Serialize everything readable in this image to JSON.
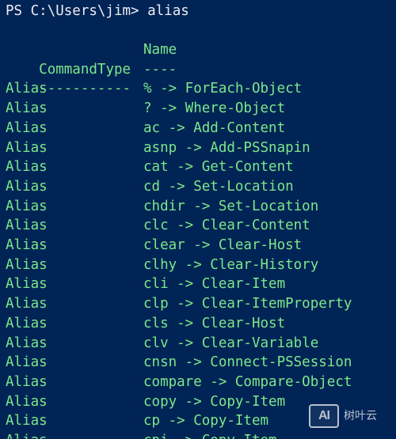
{
  "prompt": {
    "text": "PS C:\\Users\\jim> alias"
  },
  "table": {
    "headers": [
      "CommandType",
      "Name"
    ],
    "separators": [
      "-----------",
      "----"
    ],
    "rows": [
      {
        "type": "Alias",
        "name": "% -> ForEach-Object"
      },
      {
        "type": "Alias",
        "name": "? -> Where-Object"
      },
      {
        "type": "Alias",
        "name": "ac -> Add-Content"
      },
      {
        "type": "Alias",
        "name": "asnp -> Add-PSSnapin"
      },
      {
        "type": "Alias",
        "name": "cat -> Get-Content"
      },
      {
        "type": "Alias",
        "name": "cd -> Set-Location"
      },
      {
        "type": "Alias",
        "name": "chdir -> Set-Location"
      },
      {
        "type": "Alias",
        "name": "clc -> Clear-Content"
      },
      {
        "type": "Alias",
        "name": "clear -> Clear-Host"
      },
      {
        "type": "Alias",
        "name": "clhy -> Clear-History"
      },
      {
        "type": "Alias",
        "name": "cli -> Clear-Item"
      },
      {
        "type": "Alias",
        "name": "clp -> Clear-ItemProperty"
      },
      {
        "type": "Alias",
        "name": "cls -> Clear-Host"
      },
      {
        "type": "Alias",
        "name": "clv -> Clear-Variable"
      },
      {
        "type": "Alias",
        "name": "cnsn -> Connect-PSSession"
      },
      {
        "type": "Alias",
        "name": "compare -> Compare-Object"
      },
      {
        "type": "Alias",
        "name": "copy -> Copy-Item"
      },
      {
        "type": "Alias",
        "name": "cp -> Copy-Item"
      },
      {
        "type": "Alias",
        "name": "cpi -> Copy-Item"
      }
    ]
  },
  "watermark": {
    "logo_text": "AI",
    "text": "树叶云"
  },
  "colors": {
    "background": "#012456",
    "output_text": "#7ce88a",
    "prompt_text": "#eeedf0"
  }
}
